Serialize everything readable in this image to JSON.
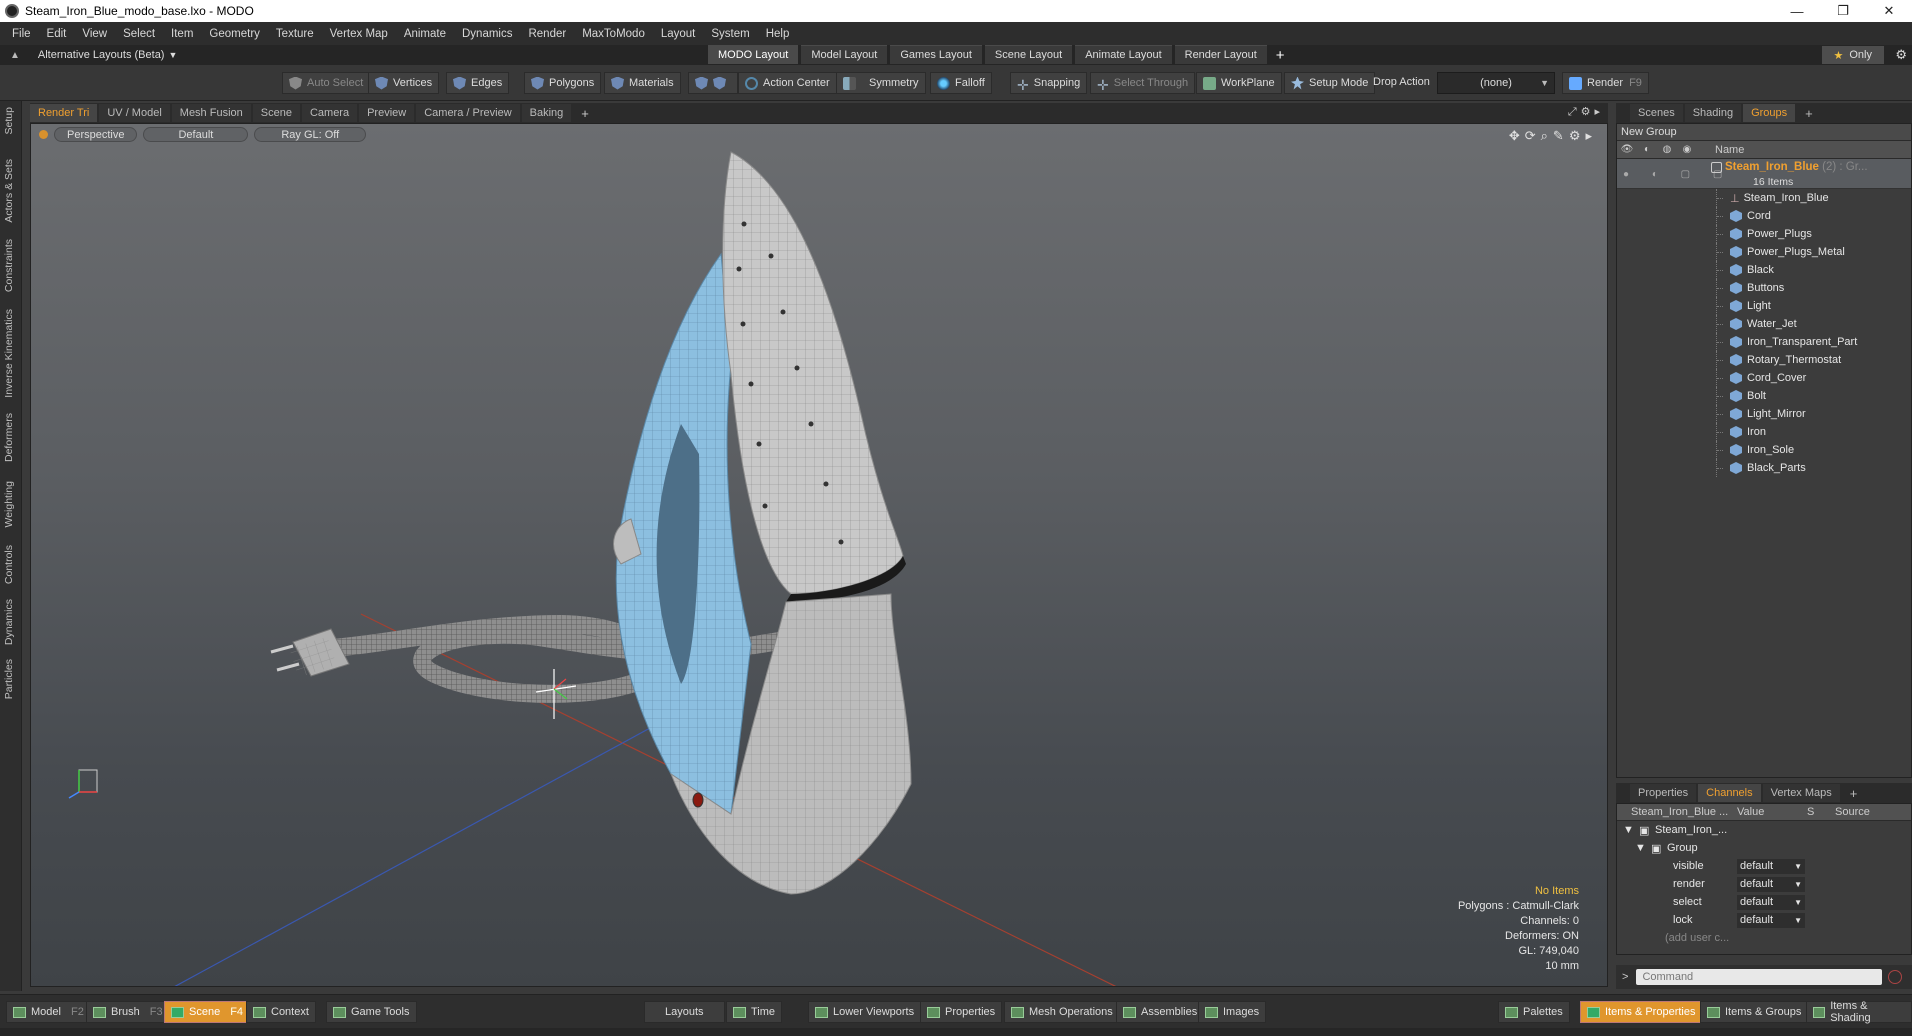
{
  "window": {
    "title": "Steam_Iron_Blue_modo_base.lxo - MODO",
    "minimize": "—",
    "restore": "❐",
    "close": "✕"
  },
  "menu": [
    "File",
    "Edit",
    "View",
    "Select",
    "Item",
    "Geometry",
    "Texture",
    "Vertex Map",
    "Animate",
    "Dynamics",
    "Render",
    "MaxToModo",
    "Layout",
    "System",
    "Help"
  ],
  "layoutbar": {
    "alt_layouts": "Alternative Layouts (Beta)",
    "tabs": [
      "MODO Layout",
      "Model Layout",
      "Games Layout",
      "Scene Layout",
      "Animate Layout",
      "Render Layout"
    ],
    "active_tab": "MODO Layout",
    "plus": "+",
    "only_label": "Only"
  },
  "toolbar": {
    "auto_select": "Auto Select",
    "vertices": "Vertices",
    "edges": "Edges",
    "polygons": "Polygons",
    "materials": "Materials",
    "action_center": "Action Center",
    "symmetry": "Symmetry",
    "falloff": "Falloff",
    "snapping": "Snapping",
    "select_through": "Select Through",
    "workplane": "WorkPlane",
    "setup_mode": "Setup Mode",
    "drop_action": "Drop Action",
    "drop_value": "(none)",
    "render": "Render",
    "render_key": "F9"
  },
  "left_tabs": [
    "Setup",
    "Actors & Sets",
    "Constraints",
    "Inverse Kinematics",
    "Deformers",
    "Weighting",
    "Controls",
    "Dynamics",
    "Particles"
  ],
  "viewport_tabs": [
    "Render Tri",
    "UV / Model",
    "Mesh Fusion",
    "Scene",
    "Camera",
    "Preview",
    "Camera / Preview",
    "Baking"
  ],
  "viewport": {
    "view": "Perspective",
    "style": "Default",
    "raygl": "Ray GL: Off",
    "info": {
      "items": "No Items",
      "polygons": "Polygons : Catmull-Clark",
      "channels": "Channels: 0",
      "deformers": "Deformers: ON",
      "gl": "GL: 749,040",
      "scale": "10 mm"
    }
  },
  "right_tabs": [
    "Scenes",
    "Shading",
    "Groups"
  ],
  "groups": {
    "new_group": "New Group",
    "name_header": "Name",
    "root_name": "Steam_Iron_Blue",
    "root_suffix": "(2) : Gr...",
    "root_count": "16 Items",
    "items": [
      "Steam_Iron_Blue",
      "Cord",
      "Power_Plugs",
      "Power_Plugs_Metal",
      "Black",
      "Buttons",
      "Light",
      "Water_Jet",
      "Iron_Transparent_Part",
      "Rotary_Thermostat",
      "Cord_Cover",
      "Bolt",
      "Light_Mirror",
      "Iron",
      "Iron_Sole",
      "Black_Parts"
    ]
  },
  "channel_tabs": [
    "Properties",
    "Channels",
    "Vertex Maps"
  ],
  "channels": {
    "header_item": "Steam_Iron_Blue ...",
    "header_value": "Value",
    "header_s": "S",
    "header_source": "Source",
    "item": "Steam_Iron_...",
    "group": "Group",
    "rows": [
      {
        "label": "visible",
        "value": "default"
      },
      {
        "label": "render",
        "value": "default"
      },
      {
        "label": "select",
        "value": "default"
      },
      {
        "label": "lock",
        "value": "default"
      }
    ],
    "add_user": "(add user c..."
  },
  "command": {
    "placeholder": "Command"
  },
  "bottom": {
    "model": "Model",
    "model_key": "F2",
    "brush": "Brush",
    "brush_key": "F3",
    "scene": "Scene",
    "scene_key": "F4",
    "context": "Context",
    "game_tools": "Game Tools",
    "layouts": "Layouts",
    "time": "Time",
    "lower_viewports": "Lower Viewports",
    "properties": "Properties",
    "mesh_operations": "Mesh Operations",
    "assemblies": "Assemblies",
    "images": "Images",
    "palettes": "Palettes",
    "items_properties": "Items & Properties",
    "items_groups": "Items & Groups",
    "items_shading": "Items & Shading"
  },
  "colors": {
    "accent": "#f0a030",
    "active_button": "#e0962d",
    "viewport_top": "#6b6d70",
    "iron_blue": "#8ec3e6"
  }
}
